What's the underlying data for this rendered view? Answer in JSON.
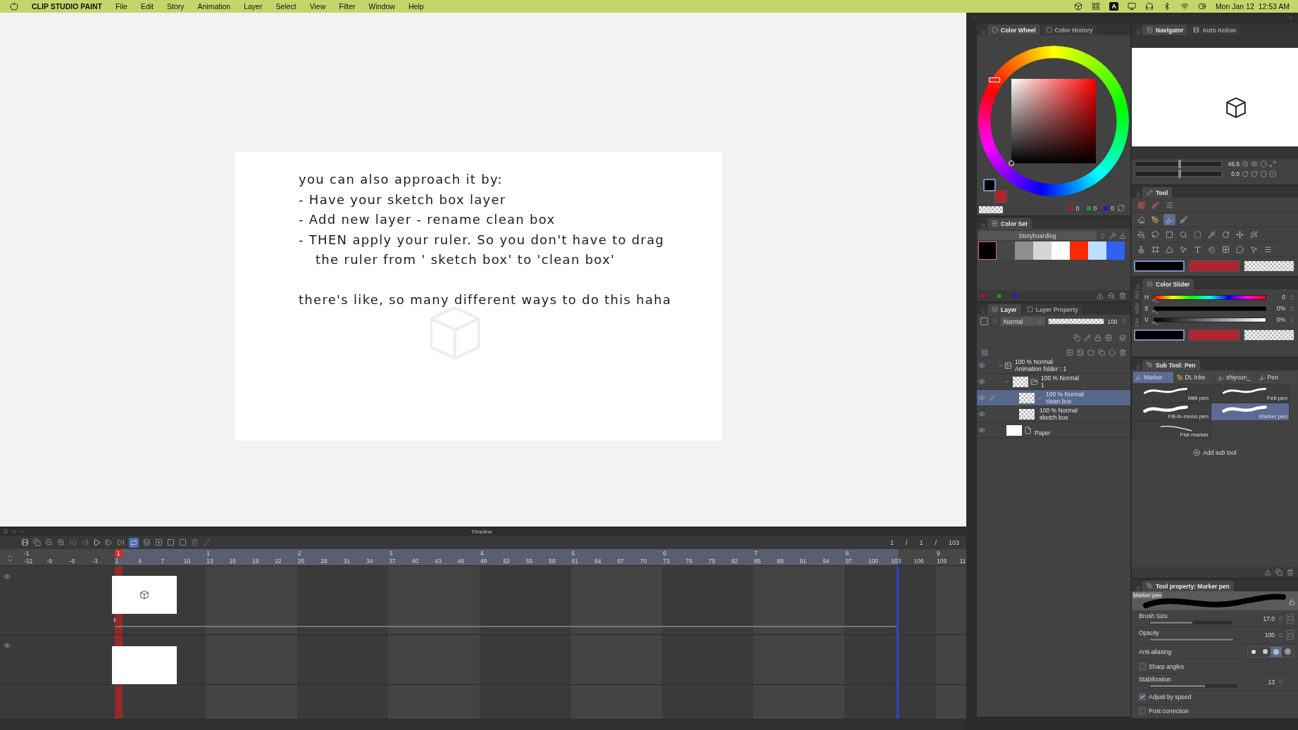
{
  "menubar": {
    "app": "CLIP STUDIO PAINT",
    "menus": [
      "File",
      "Edit",
      "Story",
      "Animation",
      "Layer",
      "Select",
      "View",
      "Filter",
      "Window",
      "Help"
    ],
    "input_source": "A",
    "clock": "Mon Jan 12  12:53 AM"
  },
  "canvas": {
    "lines": [
      {
        "text": "you can also approach it by:",
        "kind": "line"
      },
      {
        "text": "- Have your sketch box layer",
        "kind": "line"
      },
      {
        "text": "- Add new layer - rename clean box",
        "kind": "line"
      },
      {
        "text": "- THEN apply your ruler. So you don't have to drag",
        "kind": "line"
      },
      {
        "text": "the ruler from ' sketch box' to 'clean box'",
        "kind": "continuation"
      },
      {
        "text": "there's like, so many different ways to do this haha",
        "kind": "paragraph"
      }
    ]
  },
  "timeline": {
    "title": "Timeline",
    "loop": true,
    "counter": [
      "1",
      "/",
      "1",
      "/",
      "103"
    ],
    "current_frame": "1",
    "second_labels": [
      "-1",
      "1",
      "2",
      "3",
      "4",
      "5",
      "6",
      "7",
      "8",
      "9"
    ],
    "frame_labels": [
      "-12",
      "-9",
      "-6",
      "-3",
      "1",
      "4",
      "7",
      "10",
      "13",
      "16",
      "19",
      "22",
      "25",
      "28",
      "31",
      "34",
      "37",
      "40",
      "43",
      "46",
      "49",
      "52",
      "55",
      "58",
      "61",
      "64",
      "67",
      "70",
      "73",
      "76",
      "79",
      "82",
      "85",
      "88",
      "91",
      "94",
      "97",
      "100",
      "103",
      "106",
      "109",
      "11"
    ],
    "tracks": [
      {
        "visible": true,
        "kind": "drawing",
        "cel_label": "1"
      },
      {
        "visible": true,
        "kind": "blank"
      }
    ]
  },
  "color_wheel": {
    "tabs": [
      {
        "label": "Color Wheel",
        "selected": true
      },
      {
        "label": "Color History",
        "selected": false
      }
    ],
    "chips": [
      {
        "color": "#000000",
        "selected": true
      },
      {
        "color": "#b22330",
        "selected": false
      }
    ],
    "rgb": [
      "0",
      "0",
      "0"
    ]
  },
  "color_set": {
    "title": "Color Set",
    "set_name": "Storyboarding",
    "swatches": [
      {
        "color": "#000000",
        "selected": true
      },
      {
        "color": "#474747",
        "selected": false
      },
      {
        "color": "#8e8e8e",
        "selected": false
      },
      {
        "color": "#d6d6d6",
        "selected": false
      },
      {
        "color": "#ffffff",
        "selected": false
      },
      {
        "color": "#ff2a00",
        "selected": false
      },
      {
        "color": "#bde0fa",
        "selected": false
      },
      {
        "color": "#2f62ee",
        "selected": false
      }
    ]
  },
  "layer": {
    "tabs": [
      {
        "label": "Layer",
        "selected": true
      },
      {
        "label": "Layer Property",
        "selected": false
      }
    ],
    "blend_mode": "Normal",
    "opacity": "100",
    "opacity_slider": {
      "level": 1
    },
    "layers": [
      {
        "mode": "100 % Normal",
        "name": "Animation folder : 1",
        "kind": "animation-folder",
        "expanded": true,
        "visible": true,
        "selected": false,
        "children": [
          {
            "mode": "100 % Normal",
            "name": "1",
            "kind": "folder",
            "expanded": true,
            "visible": true,
            "selected": false,
            "children": [
              {
                "mode": "100 % Normal",
                "name": "clean box",
                "kind": "ruler-raster",
                "visible": true,
                "selected": true
              },
              {
                "mode": "100 % Normal",
                "name": "sketch box",
                "kind": "raster",
                "visible": true,
                "selected": false
              }
            ]
          }
        ]
      },
      {
        "name": "Paper",
        "kind": "paper",
        "visible": true,
        "selected": false
      }
    ]
  },
  "navigator": {
    "tabs": [
      {
        "label": "Navigator",
        "selected": true
      },
      {
        "label": "Auto Action",
        "selected": false
      }
    ],
    "zoom": "46.6",
    "zoom_slider": {
      "level": 0.5
    },
    "rotation": "0.0",
    "rotation_slider": {
      "level": 0.5
    }
  },
  "tool": {
    "title": "Tool",
    "rows": [
      [
        {
          "selected": false
        },
        {
          "selected": false
        },
        {
          "selected": false
        }
      ],
      [
        {
          "selected": false
        },
        {
          "selected": false
        },
        {
          "selected": true
        },
        {
          "selected": false
        }
      ],
      [
        {
          "selected": false
        },
        {
          "selected": false
        },
        {
          "selected": false
        },
        {
          "selected": false
        },
        {
          "selected": false
        },
        {
          "selected": false
        },
        {
          "selected": false
        },
        {
          "selected": false
        },
        {
          "selected": false
        }
      ],
      [
        {
          "selected": false
        },
        {
          "selected": false
        },
        {
          "selected": false
        },
        {
          "selected": false
        },
        {
          "selected": false
        },
        {
          "selected": false
        },
        {
          "selected": false
        },
        {
          "selected": false
        },
        {
          "selected": false
        },
        {
          "selected": false
        }
      ]
    ],
    "chips": [
      {
        "kind": "color",
        "color": "#000000",
        "selected": true
      },
      {
        "kind": "color",
        "color": "#b22330",
        "selected": false
      },
      {
        "kind": "transparent",
        "selected": false
      }
    ]
  },
  "color_slider": {
    "title": "Color Slider",
    "modes": [
      "RG",
      "HSV",
      "CM"
    ],
    "sliders": [
      {
        "label": "H",
        "value": "0",
        "level": 0,
        "kind": "hue"
      },
      {
        "label": "S",
        "value": "0%",
        "level": 0,
        "kind": "saturation"
      },
      {
        "label": "V",
        "value": "0%",
        "level": 0,
        "kind": "brightness"
      }
    ],
    "chips": [
      {
        "kind": "color",
        "color": "#000000",
        "selected": true
      },
      {
        "kind": "color",
        "color": "#b22330",
        "selected": false
      },
      {
        "kind": "transparent",
        "selected": false
      }
    ]
  },
  "sub_tool": {
    "title": "Sub Tool: Pen",
    "groups": [
      {
        "label": "Marker",
        "selected": true
      },
      {
        "label": "DL Inks",
        "selected": false
      },
      {
        "label": "shiyoon_",
        "selected": false
      },
      {
        "label": "Pen",
        "selected": false
      }
    ],
    "brushes": [
      {
        "name": "Milli pen",
        "kind": "round",
        "selected": false
      },
      {
        "name": "Felt pen",
        "kind": "round",
        "selected": false
      },
      {
        "name": "Fill-in-mono pen",
        "kind": "bold",
        "selected": false
      },
      {
        "name": "Marker pen",
        "kind": "bold",
        "selected": true
      },
      {
        "name": "Flat marker",
        "kind": "thin",
        "selected": false
      }
    ],
    "add_label": "Add sub tool"
  },
  "tool_property": {
    "title": "Tool property: Marker pen",
    "preview_label": "Marker pen",
    "settings": [
      {
        "kind": "slider",
        "label": "Brush Size",
        "value": "17.0",
        "level": 0.52,
        "pressure_button": true
      },
      {
        "kind": "slider",
        "label": "Opacity",
        "value": "100",
        "level": 1,
        "pressure_button": true
      },
      {
        "kind": "options",
        "label": "Anti-aliasing",
        "options": [
          {
            "selected": false
          },
          {
            "selected": false
          },
          {
            "selected": true
          },
          {
            "selected": false
          }
        ]
      },
      {
        "kind": "checkbox",
        "label": "Sharp angles",
        "checked": false
      },
      {
        "kind": "slider",
        "label": "Stabilization",
        "value": "13",
        "level": 0.64,
        "pressure_button": false
      },
      {
        "kind": "checkbox",
        "label": "Adjust by speed",
        "checked": true
      },
      {
        "kind": "checkbox",
        "label": "Post correction",
        "checked": false
      }
    ]
  }
}
